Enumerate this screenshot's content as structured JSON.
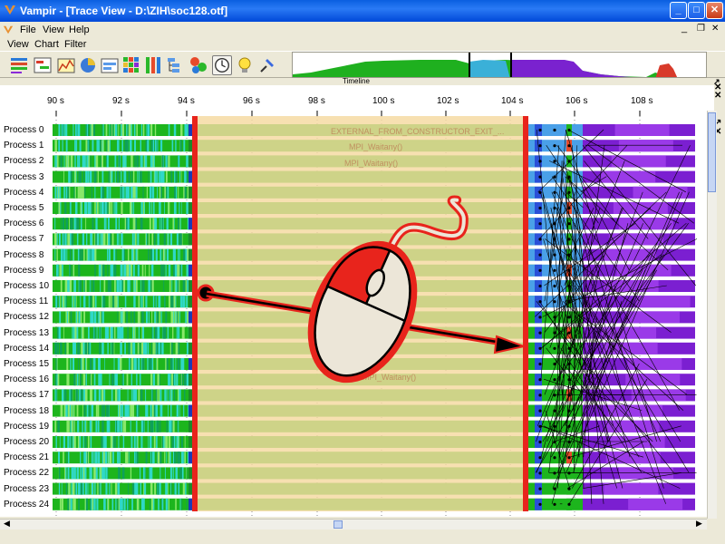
{
  "window": {
    "title": "Vampir - [Trace View - D:\\ZIH\\soc128.otf]"
  },
  "menu_main": [
    "File",
    "View",
    "Help"
  ],
  "menu_chart": [
    "View",
    "Chart",
    "Filter"
  ],
  "toolbar": {
    "icons": [
      "master-timeline-icon",
      "process-timeline-icon",
      "counter-timeline-icon",
      "function-summary-icon",
      "message-summary-icon",
      "communication-matrix-icon",
      "process-summary-icon",
      "call-tree-icon",
      "call-graph-icon",
      "clock-icon",
      "lightbulb-icon",
      "pin-icon"
    ]
  },
  "timeline": {
    "label": "Timeline",
    "ticks": [
      "90 s",
      "92 s",
      "94 s",
      "96 s",
      "98 s",
      "100 s",
      "102 s",
      "104 s",
      "106 s",
      "108 s"
    ],
    "processes": [
      "Process 0",
      "Process 1",
      "Process 2",
      "Process 3",
      "Process 4",
      "Process 5",
      "Process 6",
      "Process 7",
      "Process 8",
      "Process 9",
      "Process 10",
      "Process 11",
      "Process 12",
      "Process 13",
      "Process 14",
      "Process 15",
      "Process 16",
      "Process 17",
      "Process 18",
      "Process 19",
      "Process 20",
      "Process 21",
      "Process 22",
      "Process 23",
      "Process 24"
    ],
    "function_labels": [
      "EXTERNAL_FROM_CONSTRUCTOR_EXIT_...",
      "MPI_Waitany()",
      "MPI_Waitany()",
      "MPI_Waitany()"
    ],
    "colors": {
      "computation": "#1db51d",
      "mpi": "#7b1fd1",
      "selection_fill": "#f5d9a0",
      "selection_border": "#e8241c",
      "message_lines": "#000000"
    }
  }
}
